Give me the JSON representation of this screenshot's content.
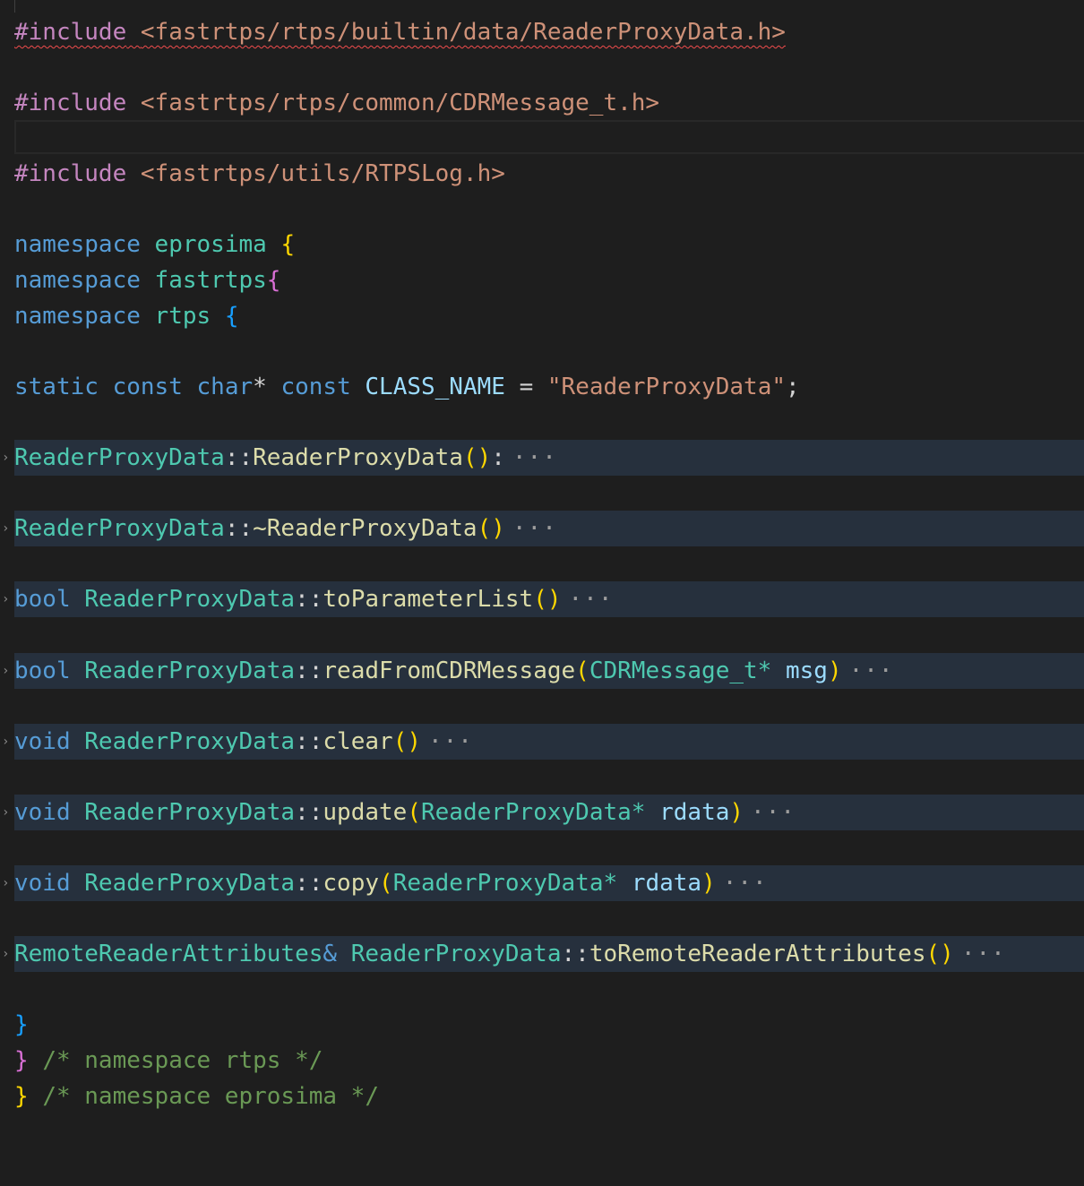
{
  "editor": {
    "language": "cpp",
    "lines": {
      "include1": {
        "directive": "#include",
        "path": "<fastrtps/rtps/builtin/data/ReaderProxyData.h>"
      },
      "include2": {
        "directive": "#include",
        "path": "<fastrtps/rtps/common/CDRMessage_t.h>"
      },
      "include3": {
        "directive": "#include",
        "path": "<fastrtps/utils/RTPSLog.h>"
      },
      "ns1": {
        "kw": "namespace",
        "name": "eprosima",
        "brace": "{"
      },
      "ns2": {
        "kw": "namespace",
        "name": "fastrtps",
        "brace": "{"
      },
      "ns3": {
        "kw": "namespace",
        "name": "rtps",
        "brace": "{"
      },
      "classname": {
        "kw_static": "static",
        "kw_const1": "const",
        "kw_char": "char",
        "star": "*",
        "kw_const2": "const",
        "var": "CLASS_NAME",
        "eq": "=",
        "value": "\"ReaderProxyData\"",
        "semi": ";"
      },
      "fold1": {
        "cls": "ReaderProxyData",
        "sep": "::",
        "fn": "ReaderProxyData",
        "parens": "()",
        "tail": ":"
      },
      "fold2": {
        "cls": "ReaderProxyData",
        "sep": "::",
        "fn": "~ReaderProxyData",
        "parens": "()"
      },
      "fold3": {
        "ret": "bool",
        "cls": "ReaderProxyData",
        "sep": "::",
        "fn": "toParameterList",
        "parens": "()"
      },
      "fold4": {
        "ret": "bool",
        "cls": "ReaderProxyData",
        "sep": "::",
        "fn": "readFromCDRMessage",
        "open": "(",
        "ptype": "CDRMessage_t",
        "pstar": "*",
        "pname": "msg",
        "close": ")"
      },
      "fold5": {
        "ret": "void",
        "cls": "ReaderProxyData",
        "sep": "::",
        "fn": "clear",
        "parens": "()"
      },
      "fold6": {
        "ret": "void",
        "cls": "ReaderProxyData",
        "sep": "::",
        "fn": "update",
        "open": "(",
        "ptype": "ReaderProxyData",
        "pstar": "*",
        "pname": "rdata",
        "close": ")"
      },
      "fold7": {
        "ret": "void",
        "cls": "ReaderProxyData",
        "sep": "::",
        "fn": "copy",
        "open": "(",
        "ptype": "ReaderProxyData",
        "pstar": "*",
        "pname": "rdata",
        "close": ")"
      },
      "fold8": {
        "rtype": "RemoteReaderAttributes",
        "amp": "&",
        "cls": "ReaderProxyData",
        "sep": "::",
        "fn": "toRemoteReaderAttributes",
        "parens": "()"
      },
      "close1": {
        "brace": "}"
      },
      "close2": {
        "brace": "}",
        "comment": "/* namespace rtps */"
      },
      "close3": {
        "brace": "}",
        "comment": "/* namespace eprosima */"
      }
    },
    "fold_ellipsis": "···",
    "fold_marker": "›"
  }
}
